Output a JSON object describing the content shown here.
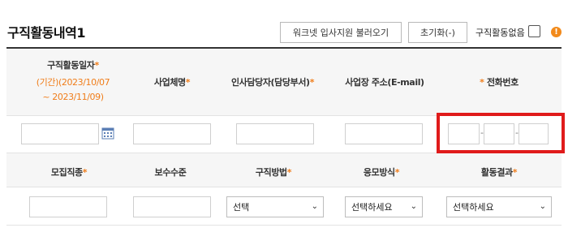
{
  "section": {
    "title": "구직활동내역1"
  },
  "toolbar": {
    "import_label": "워크넷 입사지원 불러오기",
    "reset_label": "초기화(-)",
    "no_activity_label": "구직활동없음",
    "info_glyph": "!"
  },
  "table1": {
    "headers": {
      "date": "구직활동일자",
      "date_period_line1": "(기간)(2023/10/07",
      "date_period_line2": "~ 2023/11/09)",
      "company": "사업체명",
      "hr_contact": "인사담당자(담당부서)",
      "address": "사업장 주소(E-mail)",
      "phone": "전화번호"
    },
    "phone_separator": "-"
  },
  "table2": {
    "headers": {
      "position": "모집직종",
      "pay": "보수수준",
      "method": "구직방법",
      "apply_way": "응모방식",
      "result": "활동결과"
    },
    "method_value": "선택",
    "apply_way_value": "선택하세요",
    "result_value": "선택하세요"
  },
  "required_mark": "*",
  "colors": {
    "accent": "#f07d1a",
    "highlight": "#e01b1b",
    "info": "#f28a1b"
  }
}
